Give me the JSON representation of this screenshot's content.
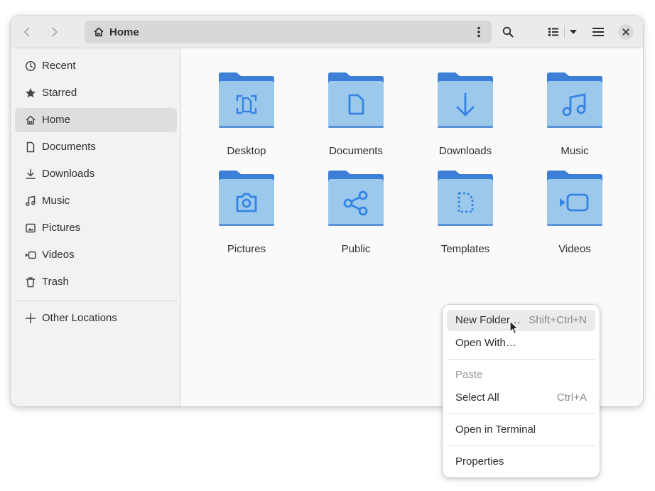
{
  "headerbar": {
    "location_label": "Home",
    "icons": {
      "back": "go-previous-icon",
      "forward": "go-next-icon",
      "location": "home-icon",
      "path_menu": "view-more-icon",
      "search": "search-icon",
      "view": "view-list-icon",
      "view_options": "chevron-down-icon",
      "main_menu": "hamburger-menu-icon",
      "close": "close-icon"
    }
  },
  "sidebar": {
    "items": [
      {
        "label": "Recent",
        "icon": "clock-icon"
      },
      {
        "label": "Starred",
        "icon": "star-icon"
      },
      {
        "label": "Home",
        "icon": "home-icon",
        "active": true
      },
      {
        "label": "Documents",
        "icon": "document-icon"
      },
      {
        "label": "Downloads",
        "icon": "download-icon"
      },
      {
        "label": "Music",
        "icon": "music-note-icon"
      },
      {
        "label": "Pictures",
        "icon": "picture-icon"
      },
      {
        "label": "Videos",
        "icon": "video-icon"
      },
      {
        "label": "Trash",
        "icon": "trash-icon"
      }
    ],
    "other_locations": {
      "label": "Other Locations",
      "icon": "plus-icon"
    }
  },
  "folders": [
    {
      "label": "Desktop",
      "icon": "desktop-folder-icon"
    },
    {
      "label": "Documents",
      "icon": "documents-folder-icon"
    },
    {
      "label": "Downloads",
      "icon": "downloads-folder-icon"
    },
    {
      "label": "Music",
      "icon": "music-folder-icon"
    },
    {
      "label": "Pictures",
      "icon": "pictures-folder-icon"
    },
    {
      "label": "Public",
      "icon": "public-folder-icon"
    },
    {
      "label": "Templates",
      "icon": "templates-folder-icon"
    },
    {
      "label": "Videos",
      "icon": "videos-folder-icon"
    }
  ],
  "context_menu": {
    "items": [
      {
        "label": "New Folder…",
        "accel": "Shift+Ctrl+N",
        "hovered": true
      },
      {
        "label": "Open With…",
        "accel": ""
      },
      {
        "label": "Paste",
        "accel": "",
        "disabled": true
      },
      {
        "label": "Select All",
        "accel": "Ctrl+A"
      },
      {
        "label": "Open in Terminal",
        "accel": ""
      },
      {
        "label": "Properties",
        "accel": ""
      }
    ]
  },
  "colors": {
    "folder_back": "#3d7fd6",
    "folder_front": "#9cc8ec",
    "folder_glyph": "#3584e4",
    "headerbar_bg": "#ebebeb",
    "sidebar_bg": "#f2f2f2",
    "active_item_bg": "#dedede"
  }
}
